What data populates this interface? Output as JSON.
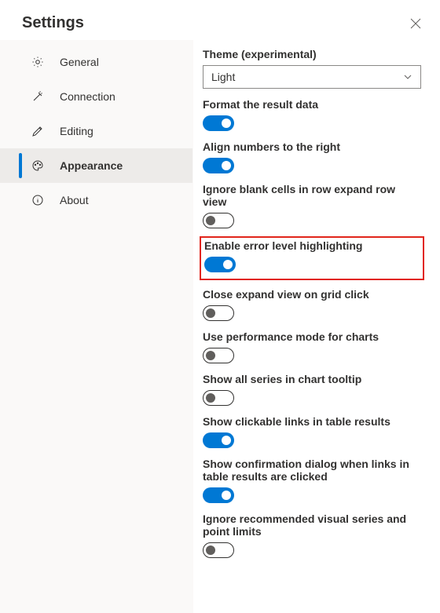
{
  "title": "Settings",
  "sidebar": {
    "items": [
      {
        "key": "general",
        "label": "General"
      },
      {
        "key": "connection",
        "label": "Connection"
      },
      {
        "key": "editing",
        "label": "Editing"
      },
      {
        "key": "appearance",
        "label": "Appearance"
      },
      {
        "key": "about",
        "label": "About"
      }
    ],
    "selected": "appearance"
  },
  "theme": {
    "label": "Theme (experimental)",
    "value": "Light"
  },
  "settings": [
    {
      "key": "format-result",
      "label": "Format the result data",
      "value": true,
      "highlight": false
    },
    {
      "key": "align-numbers",
      "label": "Align numbers to the right",
      "value": true,
      "highlight": false
    },
    {
      "key": "ignore-blank",
      "label": "Ignore blank cells in row expand row view",
      "value": false,
      "highlight": false
    },
    {
      "key": "error-highlight",
      "label": "Enable error level highlighting",
      "value": true,
      "highlight": true
    },
    {
      "key": "close-expand",
      "label": "Close expand view on grid click",
      "value": false,
      "highlight": false
    },
    {
      "key": "perf-mode-charts",
      "label": "Use performance mode for charts",
      "value": false,
      "highlight": false
    },
    {
      "key": "all-series-tooltip",
      "label": "Show all series in chart tooltip",
      "value": false,
      "highlight": false
    },
    {
      "key": "clickable-links",
      "label": "Show clickable links in table results",
      "value": true,
      "highlight": false
    },
    {
      "key": "link-confirm",
      "label": "Show confirmation dialog when links in table results are clicked",
      "value": true,
      "highlight": false
    },
    {
      "key": "ignore-limits",
      "label": "Ignore recommended visual series and point limits",
      "value": false,
      "highlight": false
    }
  ],
  "colors": {
    "accent": "#0078d4",
    "highlight_border": "#e1251b"
  }
}
